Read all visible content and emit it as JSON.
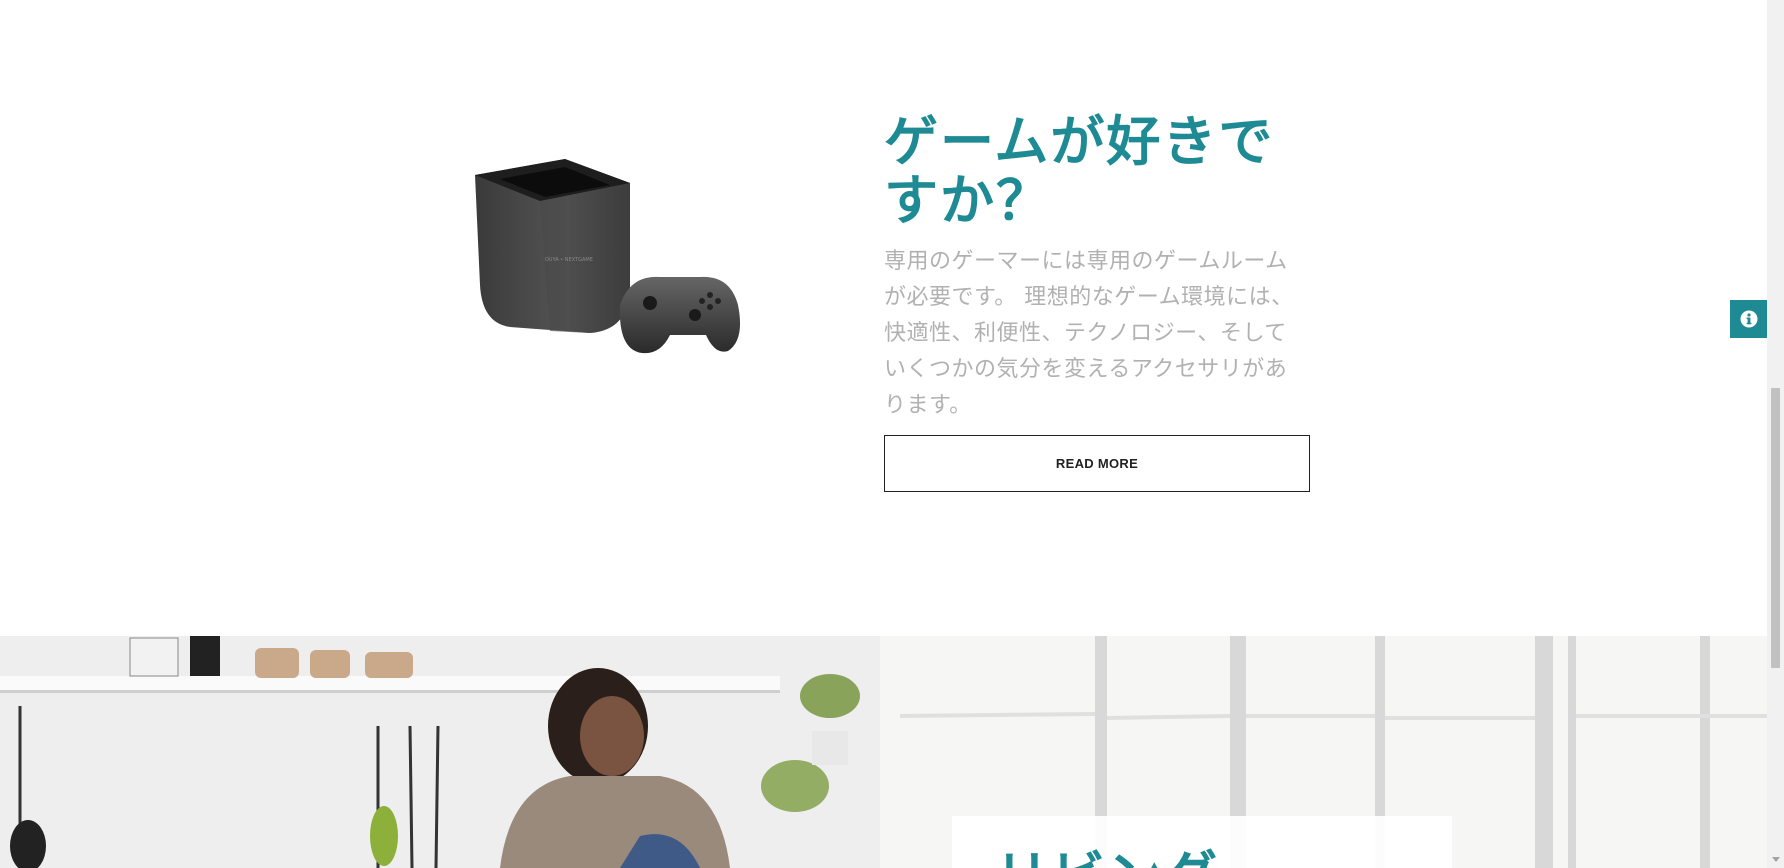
{
  "feature": {
    "title": "ゲームが好きですか？",
    "body": "専用のゲーマーには専用のゲームルームが必要です。 理想的なゲーム環境には、快適性、利便性、テクノロジー、そしていくつかの気分を変えるアクセサリがあります。",
    "button_label": "READ MORE",
    "console_brand": "OUYA • NEXTGAME"
  },
  "info_tab": {
    "icon": "info-icon"
  },
  "hero": {
    "title": "リビング"
  },
  "colors": {
    "accent": "#1e8a93",
    "body_text": "#b1b1b1",
    "border": "#222222"
  }
}
